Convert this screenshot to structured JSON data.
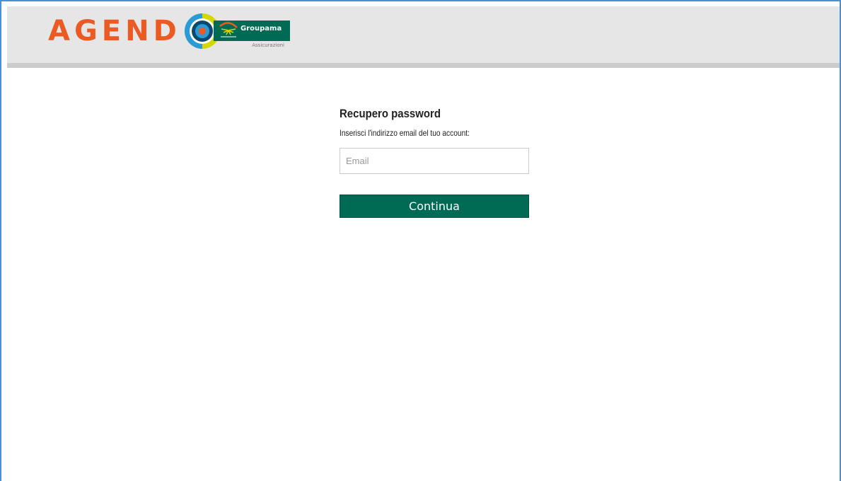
{
  "header": {
    "logo_text": "AGEND",
    "partner": {
      "name": "Groupama",
      "sub": "Assicurazioni",
      "color": "#006b54"
    },
    "logo_colors": {
      "text": "#ec5a24",
      "ring_outer": "#d3d800",
      "ring_mid": "#2a9bd6",
      "ring_inner": "#0b4a6e",
      "center": "#ec5a24"
    }
  },
  "form": {
    "title": "Recupero password",
    "instruction": "Inserisci l'indirizzo email del tuo account:",
    "email": {
      "value": "",
      "placeholder": "Email"
    },
    "continue_label": "Continua"
  }
}
